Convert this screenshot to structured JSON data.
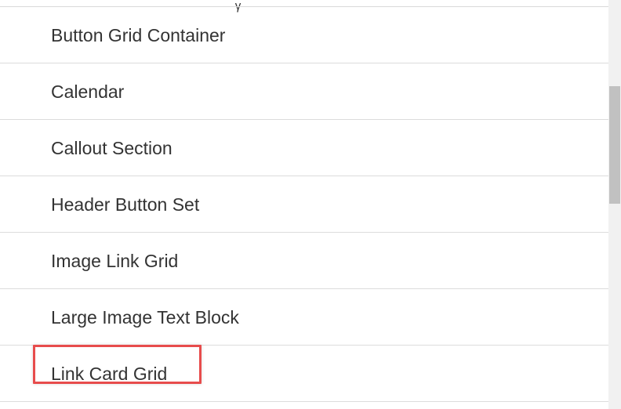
{
  "list": {
    "items": [
      {
        "label": "Button Grid Container"
      },
      {
        "label": "Calendar"
      },
      {
        "label": "Callout Section"
      },
      {
        "label": "Header Button Set"
      },
      {
        "label": "Image Link Grid"
      },
      {
        "label": "Large Image Text Block"
      },
      {
        "label": "Link Card Grid"
      }
    ],
    "highlighted_item": "Link Card Grid"
  },
  "colors": {
    "highlight_border": "#e74c4c",
    "text": "#333333",
    "divider": "#dcdcdc",
    "scroll_thumb": "#c1c1c1"
  }
}
